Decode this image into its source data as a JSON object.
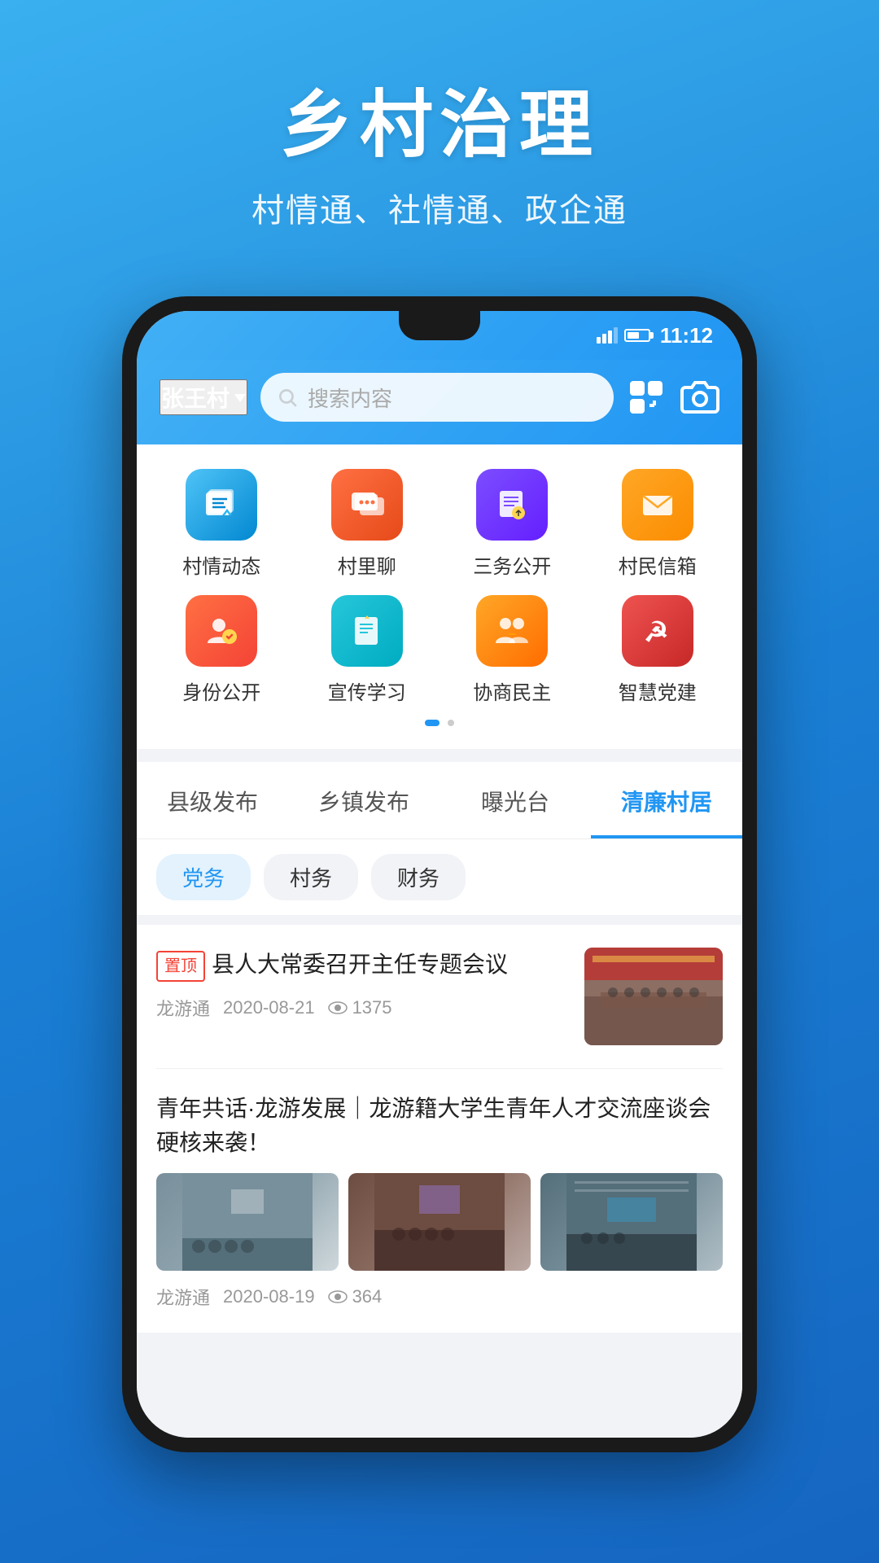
{
  "app": {
    "title": "乡村治理",
    "subtitle": "村情通、社情通、政企通"
  },
  "status_bar": {
    "time": "11:12"
  },
  "header": {
    "location": "张王村",
    "search_placeholder": "搜索内容"
  },
  "menu": {
    "items": [
      {
        "id": "cqdt",
        "icon": "🏛",
        "label": "村情动态",
        "icon_class": "icon-cqdt"
      },
      {
        "id": "vlc",
        "icon": "💬",
        "label": "村里聊",
        "icon_class": "icon-vlc"
      },
      {
        "id": "swgk",
        "icon": "📋",
        "label": "三务公开",
        "icon_class": "icon-swgk"
      },
      {
        "id": "vmxb",
        "icon": "✉",
        "label": "村民信箱",
        "icon_class": "icon-vmxb"
      },
      {
        "id": "sfgk",
        "icon": "👤",
        "label": "身份公开",
        "icon_class": "icon-sfgk"
      },
      {
        "id": "xcxx",
        "icon": "📄",
        "label": "宣传学习",
        "icon_class": "icon-xcxx"
      },
      {
        "id": "xsmd",
        "icon": "🤝",
        "label": "协商民主",
        "icon_class": "icon-xsmd"
      },
      {
        "id": "zhdj",
        "icon": "☭",
        "label": "智慧党建",
        "icon_class": "icon-zhdj"
      }
    ]
  },
  "main_tabs": [
    {
      "id": "xjfb",
      "label": "县级发布",
      "active": false
    },
    {
      "id": "xzfb",
      "label": "乡镇发布",
      "active": false
    },
    {
      "id": "qgt",
      "label": "曝光台",
      "active": false
    },
    {
      "id": "qlvj",
      "label": "清廉村居",
      "active": true
    }
  ],
  "sub_tabs": [
    {
      "id": "dw",
      "label": "党务",
      "active": true
    },
    {
      "id": "cw",
      "label": "村务",
      "active": false
    },
    {
      "id": "cw2",
      "label": "财务",
      "active": false
    }
  ],
  "news_items": [
    {
      "id": "n1",
      "top": true,
      "title": "县人大常委召开主任专题会议",
      "source": "龙游通",
      "date": "2020-08-21",
      "views": "1375",
      "has_thumb": true
    },
    {
      "id": "n2",
      "top": false,
      "title": "青年共话·龙游发展｜龙游籍大学生青年人才交流座谈会硬核来袭！",
      "source": "龙游通",
      "date": "2020-08-19",
      "views": "364",
      "has_three_images": true
    }
  ],
  "labels": {
    "top_badge": "置顶",
    "eye_icon": "👁"
  }
}
